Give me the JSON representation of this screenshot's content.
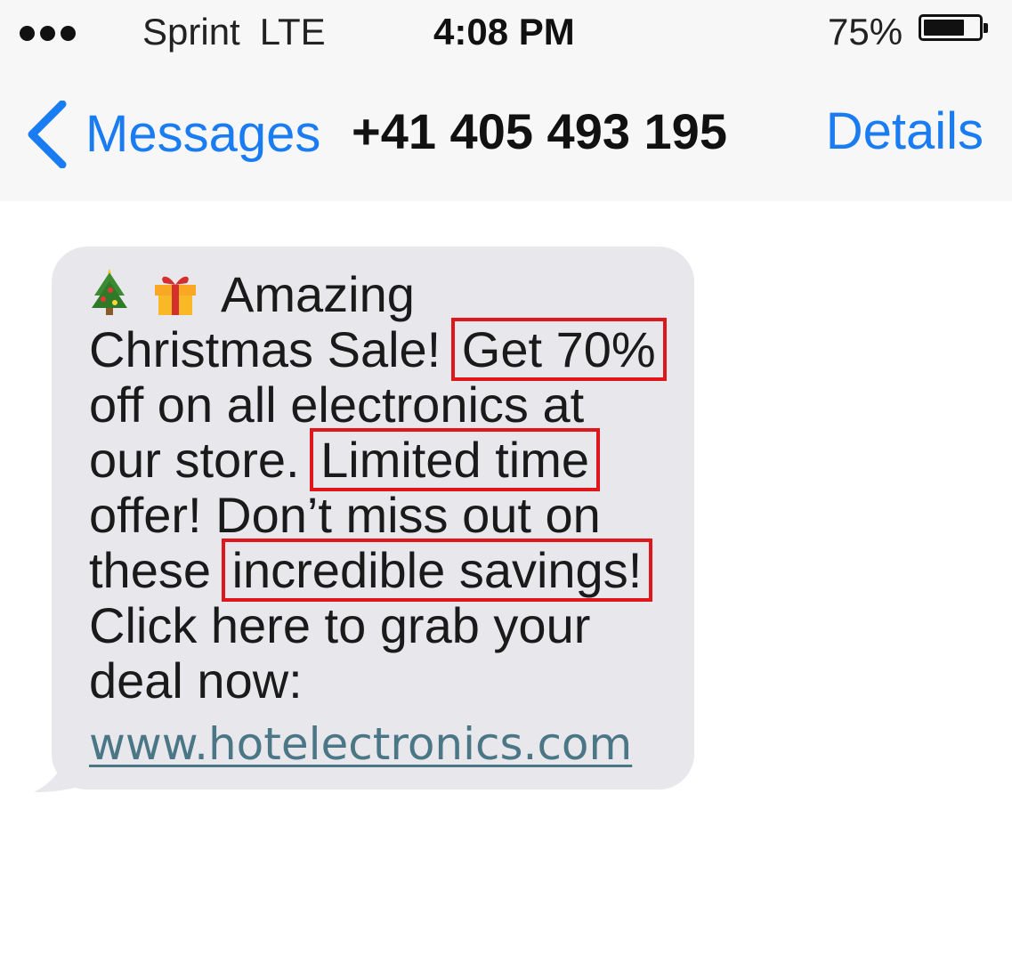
{
  "status_bar": {
    "carrier": "Sprint",
    "network": "LTE",
    "time": "4:08 PM",
    "battery_percent": "75%",
    "battery_level": 0.75,
    "signal_icon": "signal-dots-icon",
    "battery_icon": "battery-icon"
  },
  "nav": {
    "back_label": "Messages",
    "back_icon": "chevron-left-icon",
    "contact": "+41 405 493 195",
    "details_label": "Details"
  },
  "message": {
    "emoji_1": "christmas-tree-icon",
    "emoji_2": "gift-icon",
    "line1": "Amazing",
    "line2_a": "Christmas Sale!",
    "line2_hl": "Get 70%",
    "line3": "off on all electronics at",
    "line4_a": "our store.",
    "line4_hl": "Limited time",
    "line5": "offer! Don’t miss out on",
    "line6_a": "these",
    "line6_hl": "incredible savings!",
    "line7": "Click here to grab your",
    "line8": "deal now:",
    "link": "www.hotelectronics.com"
  },
  "colors": {
    "accent": "#1a7cf3",
    "bubble": "#e7e7ec",
    "highlight_box": "#e0161d",
    "link": "#4a7686"
  }
}
